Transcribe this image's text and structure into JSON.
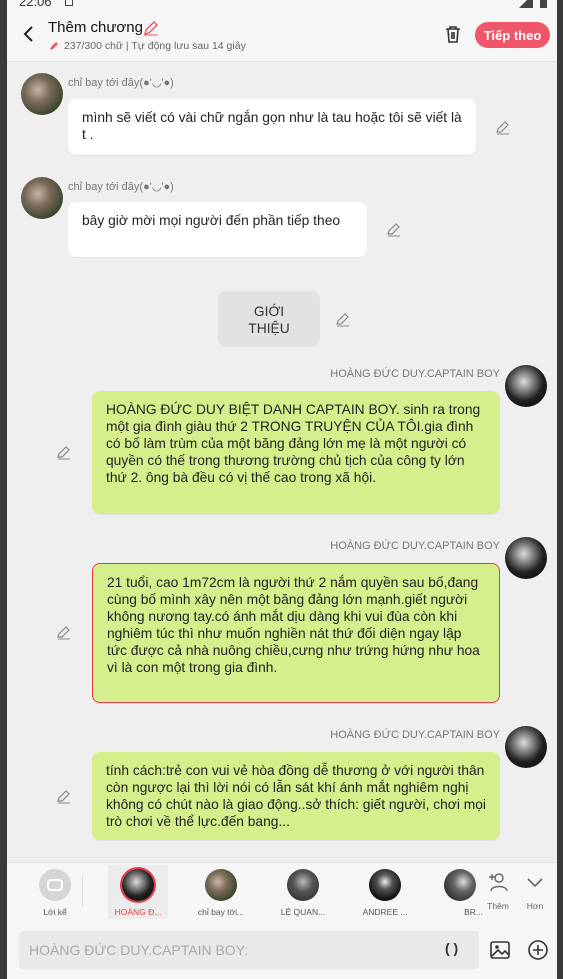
{
  "status_bar": {
    "time": "22:06"
  },
  "header": {
    "title": "Thêm chương",
    "subtitle": "237/300 chữ | Tự động lưu sau 14 giây",
    "next_label": "Tiếp theo"
  },
  "messages": [
    {
      "sender": "chỉ bay tới đây(●'◡'●)",
      "text": "mình sẽ viết có vài chữ ngắn gọn như là tau hoặc tôi sẽ viết là t .",
      "side": "left"
    },
    {
      "sender": "chỉ bay tới đây(●'◡'●)",
      "text": "bây giờ mời mọi người đến phần tiếp theo",
      "side": "left"
    },
    {
      "sender": "",
      "text": "GIỚI THIỆU",
      "side": "center"
    },
    {
      "sender": "HOÀNG ĐỨC DUY.CAPTAIN BOY",
      "text": "HOÀNG ĐỨC DUY BIỆT DANH CAPTAIN BOY. sinh ra trong một gia đình giàu thứ 2 TRONG TRUYỆN CỦA TÔI.gia đình có bố làm trùm của một băng đảng lớn mẹ là một người có quyền có thế trong thương trường chủ tịch của công ty lớn thứ 2. ông bà đều có vị thế cao trong xã hội.",
      "side": "right"
    },
    {
      "sender": "HOÀNG ĐỨC DUY.CAPTAIN BOY",
      "text": "21 tuổi, cao 1m72cm là người thứ 2 nắm quyền sau bố,đang cùng bố mình xây nên một băng đảng lớn mạnh.giết người không nương tay.có ánh mắt dịu dàng khi vui đùa còn khi nghiêm túc thì như muốn nghiền nát thứ đối diện ngay lập tức được cả nhà nuông chiều,cưng như trứng hứng như hoa vì là con một trong gia đình.",
      "side": "right"
    },
    {
      "sender": "HOÀNG ĐỨC DUY.CAPTAIN BOY",
      "text": "tính cách:trẻ con vui vẻ hòa đồng dễ thương ở với người thân còn ngược lại thì lời nói có lẫn sát khí ánh mắt nghiêm nghị không có chút nào là giao động..sở thích: giết người, chơi mọi trò chơi về thể lực.đến bang...",
      "side": "right"
    }
  ],
  "characters": [
    {
      "name": "Lời kể",
      "icon": "chat-bubble-icon"
    },
    {
      "name": "HOÀNG Đ...",
      "active": true
    },
    {
      "name": "chỉ bay tới..."
    },
    {
      "name": "LÊ QUAN..."
    },
    {
      "name": "ANDREE ..."
    },
    {
      "name": "BR..."
    }
  ],
  "side_buttons": {
    "add_label": "Thêm",
    "more_label": "Hơn"
  },
  "input": {
    "placeholder": "HOÀNG ĐỨC DUY.CAPTAIN BOY:",
    "paren": "( )"
  },
  "colors": {
    "accent": "#f0566a",
    "green_bubble": "#d5ef8d",
    "selected_border": "#e53b4b"
  }
}
